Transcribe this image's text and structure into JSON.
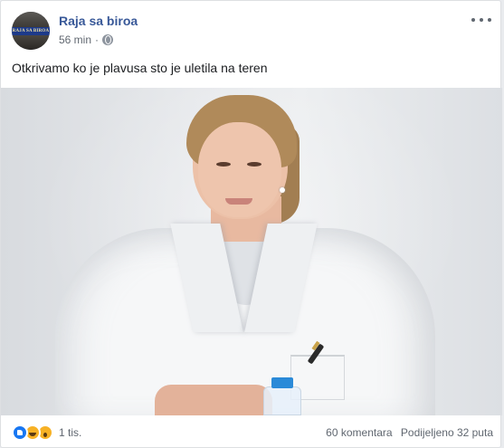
{
  "post": {
    "page_name": "Raja sa biroa",
    "avatar_text": "RAJA SA BIROA",
    "time": "56 min",
    "separator": "·",
    "privacy_icon": "globe-icon",
    "more_icon": "more-options-icon",
    "text": "Otkrivamo ko je plavusa sto je uletila na teren"
  },
  "footer": {
    "reaction_icons": [
      "like-icon",
      "haha-icon",
      "wow-icon"
    ],
    "reaction_count": "1 tis.",
    "comments": "60 komentara",
    "shares": "Podijeljeno 32 puta"
  },
  "colors": {
    "link": "#385898",
    "secondary_text": "#606770",
    "like_blue": "#1877f2",
    "emoji_yellow": "#f7b125"
  }
}
